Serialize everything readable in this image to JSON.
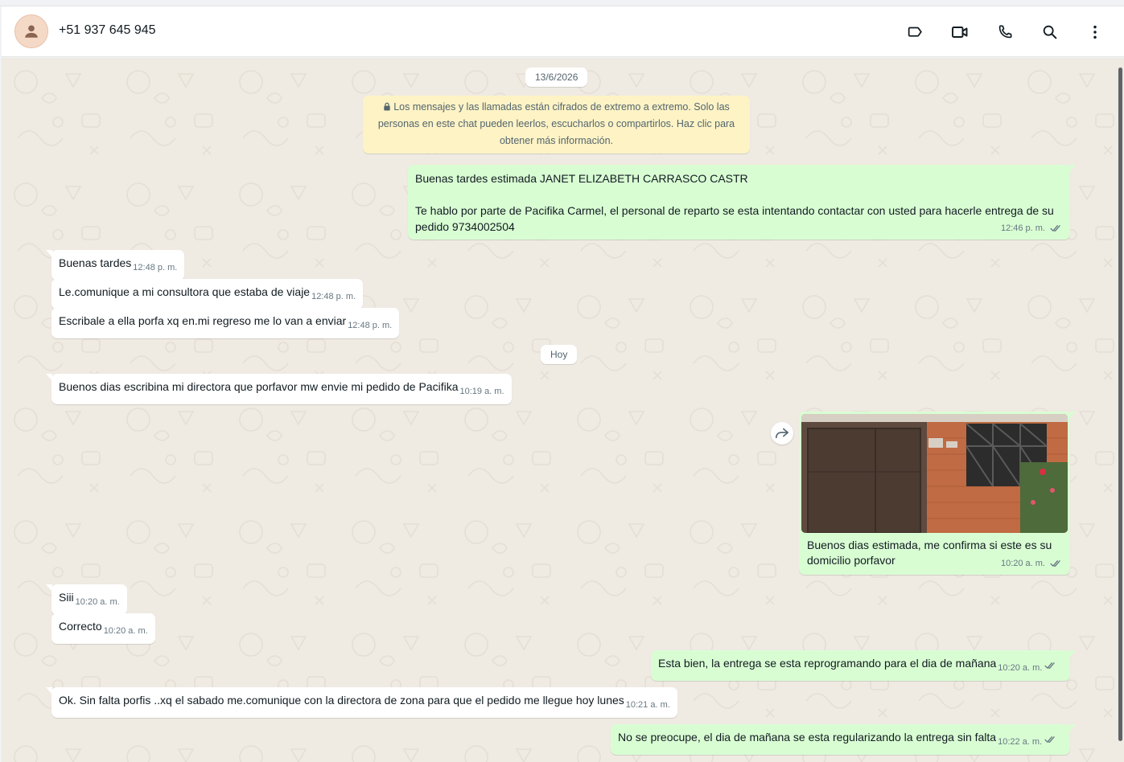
{
  "header": {
    "contact_name": "+51 937 645 945",
    "icons": [
      "label-icon",
      "video-call-icon",
      "voice-call-icon",
      "search-icon",
      "menu-icon"
    ]
  },
  "colors": {
    "chat_bg": "#efeae2",
    "incoming_bubble": "#ffffff",
    "outgoing_bubble": "#d9fdd3",
    "notice_bg": "#fdf3c5",
    "read_ticks": "#667781"
  },
  "chat": {
    "date_1": "13/6/2026",
    "encryption_notice": "Los mensajes y las llamadas están cifrados de extremo a extremo. Solo las personas en este chat pueden leerlos, escucharlos o compartirlos. Haz clic para obtener más información.",
    "date_2": "Hoy",
    "messages": [
      {
        "direction": "out",
        "line1": "Buenas tardes estimada JANET ELIZABETH CARRASCO CASTR",
        "line2": "Te hablo por parte de Pacifika Carmel, el personal de reparto se esta intentando contactar con usted para hacerle entrega de su",
        "line3": "pedido 9734002504",
        "time": "12:46 p. m."
      },
      {
        "direction": "in",
        "text": "Buenas tardes",
        "time": "12:48 p. m."
      },
      {
        "direction": "in",
        "text": "Le.comunique a mi consultora que estaba de viaje",
        "time": "12:48 p. m."
      },
      {
        "direction": "in",
        "text": "Escribale a ella porfa xq en.mi regreso me lo van a enviar",
        "time": "12:48 p. m."
      },
      {
        "direction": "in",
        "text": "Buenos dias escribina mi directora que porfavor mw envie mi pedido de Pacifika",
        "time": "10:19 a. m."
      },
      {
        "direction": "out",
        "type": "image",
        "caption_line1": "Buenos dias estimada, me confirma si este es su",
        "caption_line2": "domicilio porfavor",
        "time": "10:20 a. m."
      },
      {
        "direction": "in",
        "text": "Siii",
        "time": "10:20 a. m."
      },
      {
        "direction": "in",
        "text": "Correcto",
        "time": "10:20 a. m."
      },
      {
        "direction": "out",
        "text": "Esta bien, la entrega se esta reprogramando para el dia de mañana",
        "time": "10:20 a. m."
      },
      {
        "direction": "in",
        "text": "Ok. Sin falta porfis ..xq el sabado me.comunique con la directora de zona para que el pedido me llegue hoy lunes",
        "time": "10:21 a. m."
      },
      {
        "direction": "out",
        "text": "No se preocupe, el dia de mañana se esta regularizando la entrega sin falta",
        "time": "10:22 a. m."
      }
    ]
  }
}
